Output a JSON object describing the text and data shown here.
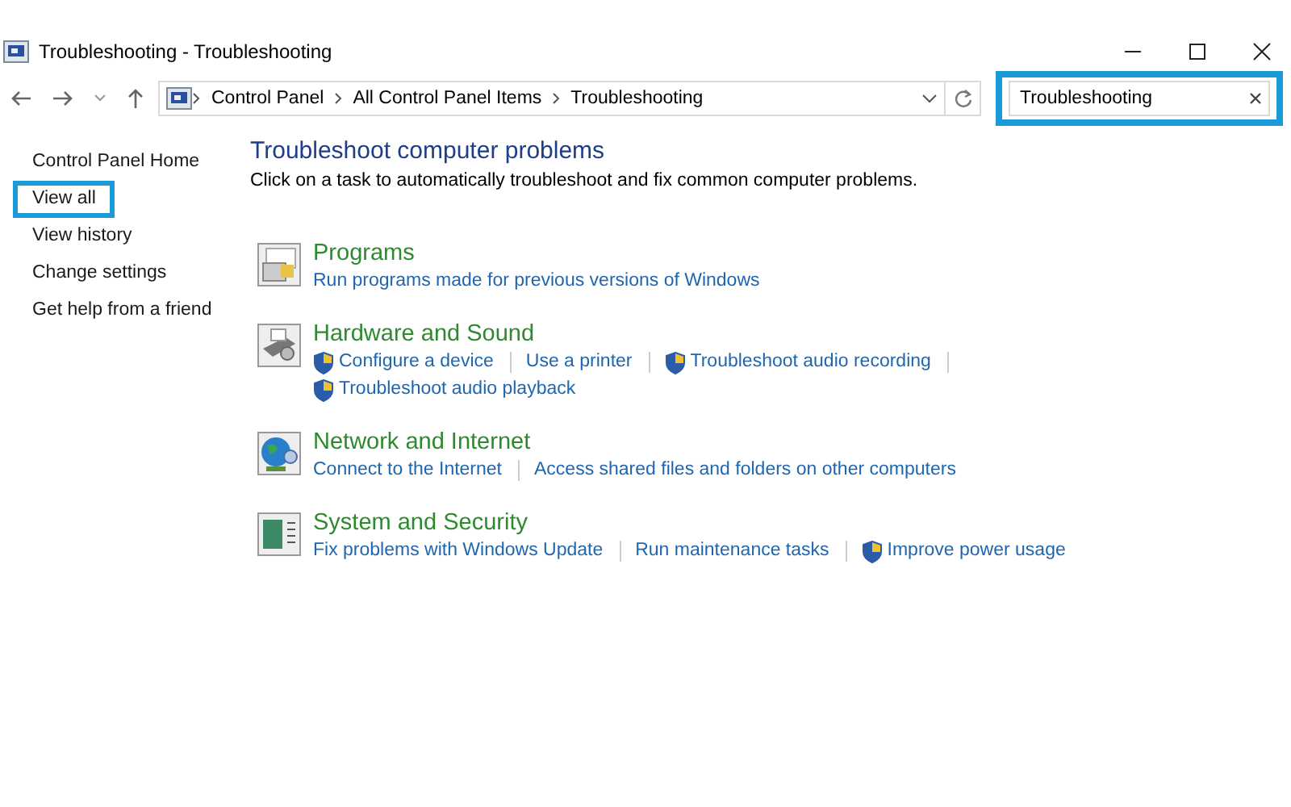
{
  "window": {
    "title": "Troubleshooting - Troubleshooting"
  },
  "address_bar": {
    "breadcrumbs": [
      "Control Panel",
      "All Control Panel Items",
      "Troubleshooting"
    ]
  },
  "search": {
    "value": "Troubleshooting",
    "highlighted": true
  },
  "sidebar": {
    "items": [
      {
        "label": "Control Panel Home",
        "highlighted": false
      },
      {
        "label": "View all",
        "highlighted": true
      },
      {
        "label": "View history",
        "highlighted": false
      },
      {
        "label": "Change settings",
        "highlighted": false
      },
      {
        "label": "Get help from a friend",
        "highlighted": false
      }
    ]
  },
  "main": {
    "heading": "Troubleshoot computer problems",
    "description": "Click on a task to automatically troubleshoot and fix common computer problems."
  },
  "categories": [
    {
      "kind": "programs",
      "title": "Programs",
      "links": [
        {
          "label": "Run programs made for previous versions of Windows",
          "shield": false
        }
      ]
    },
    {
      "kind": "hardware",
      "title": "Hardware and Sound",
      "links": [
        {
          "label": "Configure a device",
          "shield": true
        },
        {
          "label": "Use a printer",
          "shield": false
        },
        {
          "label": "Troubleshoot audio recording",
          "shield": true
        },
        {
          "label": "Troubleshoot audio playback",
          "shield": true
        }
      ]
    },
    {
      "kind": "network",
      "title": "Network and Internet",
      "links": [
        {
          "label": "Connect to the Internet",
          "shield": false
        },
        {
          "label": "Access shared files and folders on other computers",
          "shield": false
        }
      ]
    },
    {
      "kind": "system",
      "title": "System and Security",
      "links": [
        {
          "label": "Fix problems with Windows Update",
          "shield": false
        },
        {
          "label": "Run maintenance tasks",
          "shield": false
        },
        {
          "label": "Improve power usage",
          "shield": true
        }
      ]
    }
  ]
}
